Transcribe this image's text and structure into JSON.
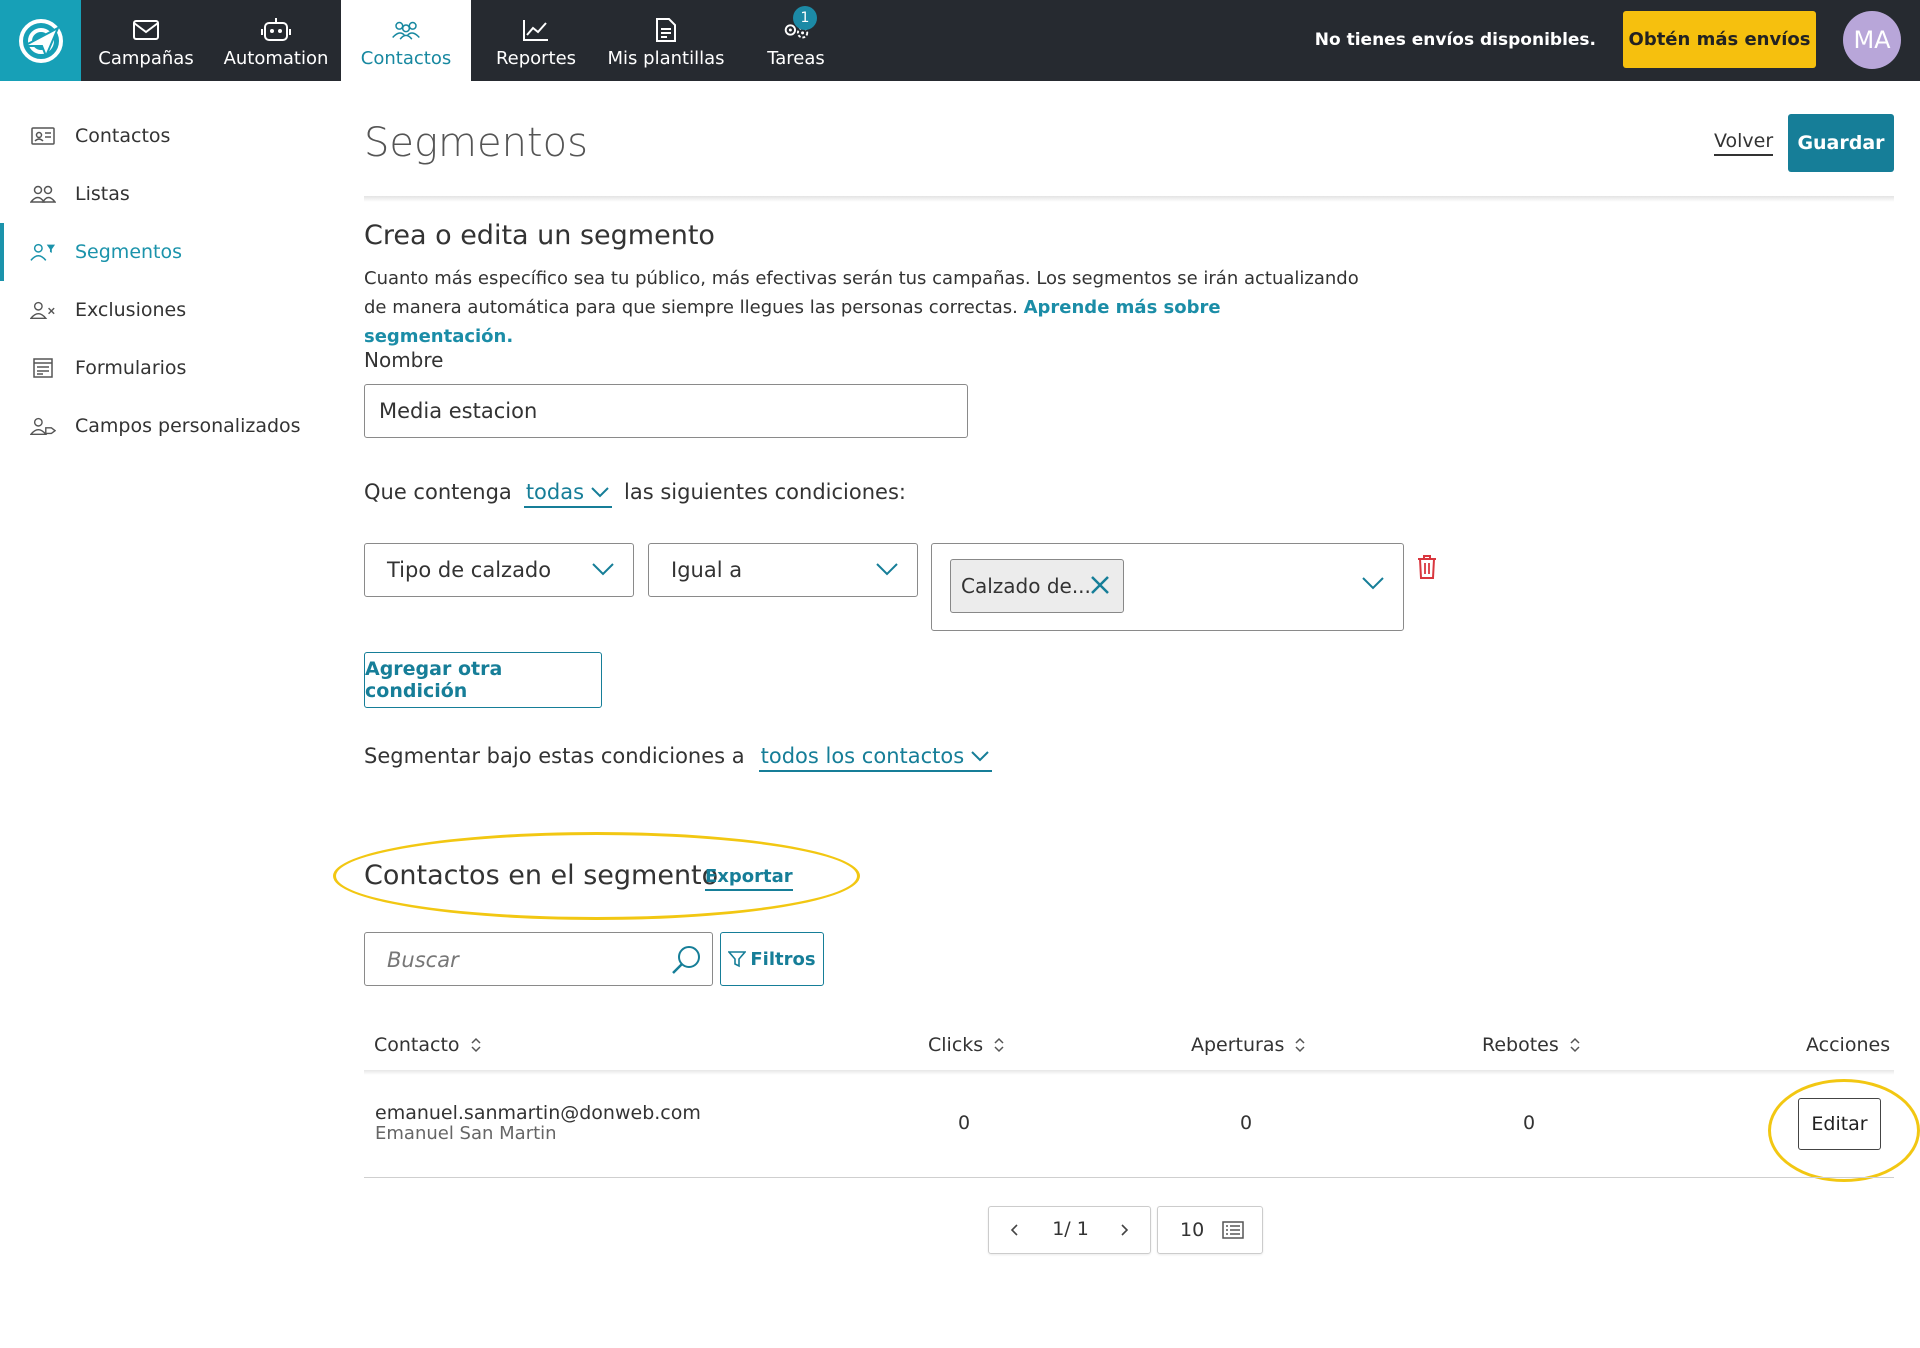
{
  "topbar": {
    "nav": [
      {
        "label": "Campañas",
        "icon": "mail-icon"
      },
      {
        "label": "Automation",
        "icon": "robot-icon"
      },
      {
        "label": "Contactos",
        "icon": "people-icon",
        "active": true
      },
      {
        "label": "Reportes",
        "icon": "chart-icon"
      },
      {
        "label": "Mis plantillas",
        "icon": "template-icon"
      },
      {
        "label": "Tareas",
        "icon": "gears-icon",
        "badge": "1"
      }
    ],
    "no_envios": "No tienes envíos disponibles.",
    "cta": "Obtén más envíos",
    "avatar": "MA",
    "colors": {
      "bar": "#262a30",
      "logo": "#17a0b7",
      "cta": "#f6c00e",
      "avatar": "#b8a6d9"
    }
  },
  "sidebar": {
    "items": [
      {
        "label": "Contactos",
        "icon": "contact-card-icon"
      },
      {
        "label": "Listas",
        "icon": "people-icon"
      },
      {
        "label": "Segmentos",
        "icon": "person-filter-icon",
        "active": true
      },
      {
        "label": "Exclusiones",
        "icon": "person-x-icon"
      },
      {
        "label": "Formularios",
        "icon": "form-icon"
      },
      {
        "label": "Campos personalizados",
        "icon": "person-tag-icon"
      }
    ]
  },
  "header": {
    "title": "Segmentos",
    "back": "Volver",
    "save": "Guardar",
    "accent": "#167e98"
  },
  "form": {
    "section_title": "Crea o edita un segmento",
    "desc": "Cuanto más específico sea tu público, más efectivas serán tus campañas. Los segmentos se irán actualizando de manera automática para que siempre llegues las personas correctas.",
    "desc_link": "Aprende más sobre segmentación.",
    "name_label": "Nombre",
    "name_value": "Media estacion",
    "cond_prefix": "Que contenga",
    "cond_match": "todas",
    "cond_suffix": "las siguientes condiciones:",
    "condition": {
      "field": "Tipo de calzado",
      "operator": "Igual a",
      "tag": "Calzado de..."
    },
    "add_condition": "Agregar otra condición",
    "scope_prefix": "Segmentar bajo estas condiciones a",
    "scope_value": "todos los contactos"
  },
  "contacts": {
    "title": "Contactos en el segmento",
    "export": "Exportar",
    "search_placeholder": "Buscar",
    "filters": "Filtros",
    "columns": {
      "contact": "Contacto",
      "clicks": "Clicks",
      "opens": "Aperturas",
      "bounces": "Rebotes",
      "actions": "Acciones"
    },
    "rows": [
      {
        "email": "emanuel.sanmartin@donweb.com",
        "name": "Emanuel San Martin",
        "clicks": "0",
        "opens": "0",
        "bounces": "0",
        "action": "Editar"
      }
    ],
    "pagination": {
      "pages": "1/ 1",
      "per_page": "10"
    }
  },
  "annotation_color": "#f2c712"
}
